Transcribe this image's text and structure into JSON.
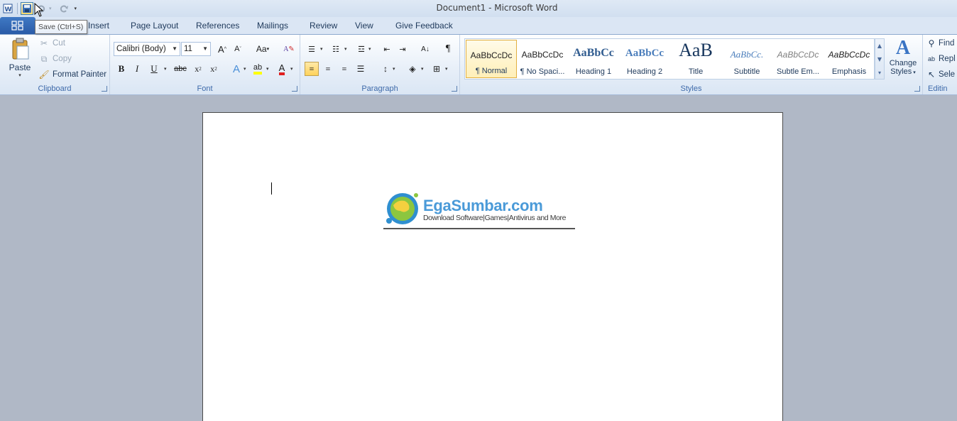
{
  "window": {
    "title": "Document1  -  Microsoft Word"
  },
  "qat": {
    "icons": [
      "word-app-icon",
      "save-icon",
      "undo-icon",
      "redo-icon",
      "customize-qat-icon"
    ]
  },
  "tooltip": "Save (Ctrl+S)",
  "tabs": [
    {
      "label": "Insert"
    },
    {
      "label": "Page Layout"
    },
    {
      "label": "References"
    },
    {
      "label": "Mailings"
    },
    {
      "label": "Review"
    },
    {
      "label": "View"
    },
    {
      "label": "Give Feedback"
    }
  ],
  "clipboard": {
    "group_label": "Clipboard",
    "paste": "Paste",
    "cut": "Cut",
    "copy": "Copy",
    "format_painter": "Format Painter"
  },
  "font": {
    "group_label": "Font",
    "font_name": "Calibri (Body)",
    "font_size": "11",
    "bold": "B",
    "italic": "I",
    "underline": "U",
    "strikethrough": "abc",
    "change_case": "Aa"
  },
  "paragraph": {
    "group_label": "Paragraph"
  },
  "styles": {
    "group_label": "Styles",
    "items": [
      {
        "sample": "AaBbCcDc",
        "name": "¶ Normal"
      },
      {
        "sample": "AaBbCcDc",
        "name": "¶ No Spaci..."
      },
      {
        "sample": "AaBbCc",
        "name": "Heading 1"
      },
      {
        "sample": "AaBbCc",
        "name": "Heading 2"
      },
      {
        "sample": "AaB",
        "name": "Title"
      },
      {
        "sample": "AaBbCc.",
        "name": "Subtitle"
      },
      {
        "sample": "AaBbCcDc",
        "name": "Subtle Em..."
      },
      {
        "sample": "AaBbCcDc",
        "name": "Emphasis"
      }
    ],
    "change_styles_line1": "Change",
    "change_styles_line2": "Styles"
  },
  "editing": {
    "group_label": "Editin",
    "find": "Find",
    "replace": "Repl",
    "select": "Sele"
  },
  "document": {
    "logo_title": "EgaSumbar.com",
    "logo_tagline": "Download Software|Games|Antivirus and More"
  }
}
